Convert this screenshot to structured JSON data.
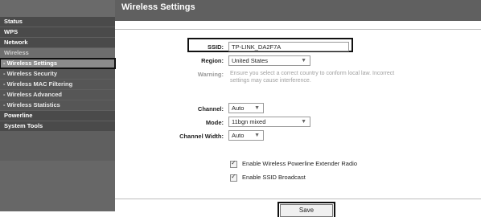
{
  "sidebar": {
    "items": [
      {
        "label": "Status",
        "state": "normal"
      },
      {
        "label": "WPS",
        "state": "normal"
      },
      {
        "label": "Network",
        "state": "normal"
      },
      {
        "label": "Wireless",
        "state": "section-open"
      },
      {
        "label": "- Wireless Settings",
        "state": "active"
      },
      {
        "label": "- Wireless Security",
        "state": "sub"
      },
      {
        "label": "- Wireless MAC Filtering",
        "state": "sub"
      },
      {
        "label": "- Wireless Advanced",
        "state": "sub"
      },
      {
        "label": "- Wireless Statistics",
        "state": "sub"
      },
      {
        "label": "Powerline",
        "state": "normal"
      },
      {
        "label": "System Tools",
        "state": "normal"
      }
    ]
  },
  "page": {
    "title": "Wireless Settings"
  },
  "form": {
    "ssid_label": "SSID:",
    "ssid_value": "TP-LINK_DA2F7A",
    "region_label": "Region:",
    "region_value": "United States",
    "warning_label": "Warning:",
    "warning_text": "Ensure you select a correct country to conform local law. Incorrect settings may cause interference.",
    "channel_label": "Channel:",
    "channel_value": "Auto",
    "mode_label": "Mode:",
    "mode_value": "11bgn mixed",
    "channel_width_label": "Channel Width:",
    "channel_width_value": "Auto",
    "extender_radio_label": "Enable Wireless Powerline Extender Radio",
    "extender_radio_checked": true,
    "ssid_broadcast_label": "Enable SSID Broadcast",
    "ssid_broadcast_checked": true,
    "save_label": "Save"
  },
  "colors": {
    "sidebar_bg": "#5f5f5f",
    "titlebar_bg": "#606060",
    "highlight": "#111111"
  }
}
